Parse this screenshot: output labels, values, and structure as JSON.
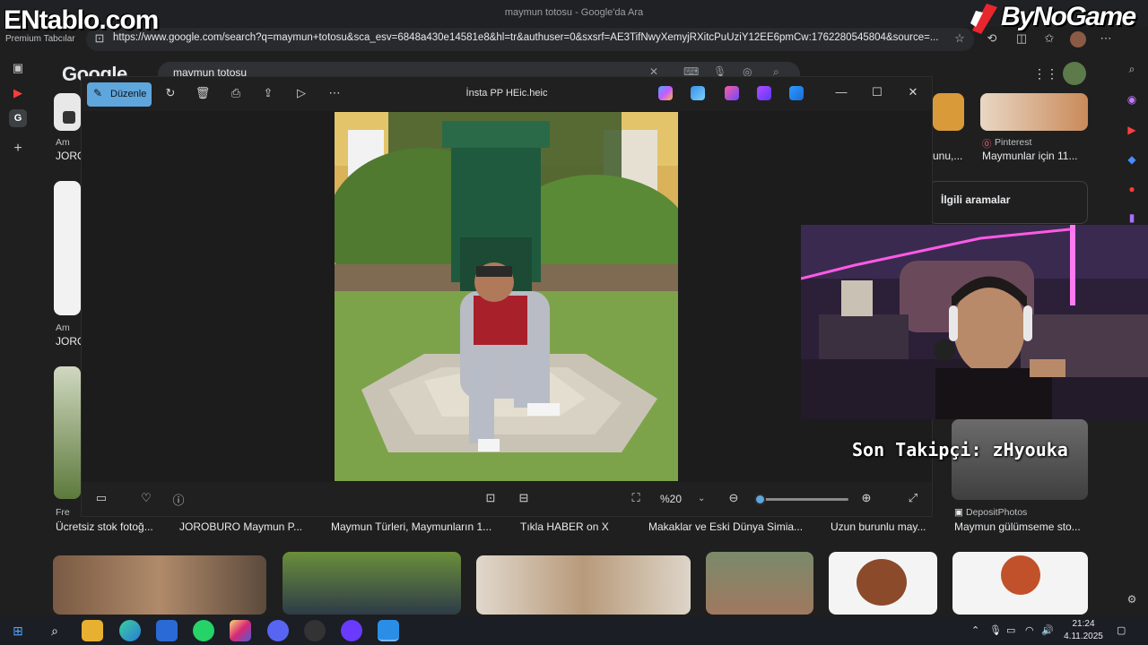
{
  "browser": {
    "window_title": "maymun totosu - Google'da Ara",
    "tab_group_label": "Premium Tabcılar",
    "url": "https://www.google.com/search?q=maymun+totosu&sca_esv=6848a430e14581e8&hl=tr&authuser=0&sxsrf=AE3TifNwyXemyjRXitcPuUziY12EE6pmCw:1762280545804&source=..."
  },
  "google": {
    "logo": "Google",
    "search_query": "maymun totosu",
    "related_title": "İlgili aramalar",
    "left_sources": [
      {
        "source": "Am",
        "caption": "JORO"
      },
      {
        "source": "Am",
        "caption": "JORO"
      },
      {
        "source": "Fre",
        "caption": ""
      }
    ],
    "top_results": [
      {
        "source": "",
        "caption": "unu,..."
      },
      {
        "source": "Pinterest",
        "caption": "Maymunlar için 11..."
      }
    ],
    "row_results": [
      {
        "caption": "Ücretsiz stok fotoğ..."
      },
      {
        "caption": "JOROBURO Maymun P..."
      },
      {
        "caption": "Maymun Türleri, Maymunların 1..."
      },
      {
        "caption": "Tıkla HABER on X"
      },
      {
        "caption": "Makaklar ve Eski Dünya Simia..."
      },
      {
        "caption": "Uzun burunlu may..."
      },
      {
        "source": "DepositPhotos",
        "caption": "Maymun gülümseme sto..."
      }
    ]
  },
  "viewer": {
    "edit_label": "Düzenle",
    "file_name": "İnsta PP HEic.heic",
    "zoom_value": "%20",
    "zoom_level_fraction": 0.05
  },
  "stream": {
    "follower_text": "Son Takipçi: zHyouka",
    "logo_left": "ENtablo.com",
    "logo_right": "ByNoGame"
  },
  "taskbar": {
    "time": "21:24",
    "date": "4.11.2025"
  },
  "colors": {
    "accent": "#5fa6dd",
    "google_bg": "#1f1f1f",
    "viewer_bg": "#1c1c1c"
  }
}
